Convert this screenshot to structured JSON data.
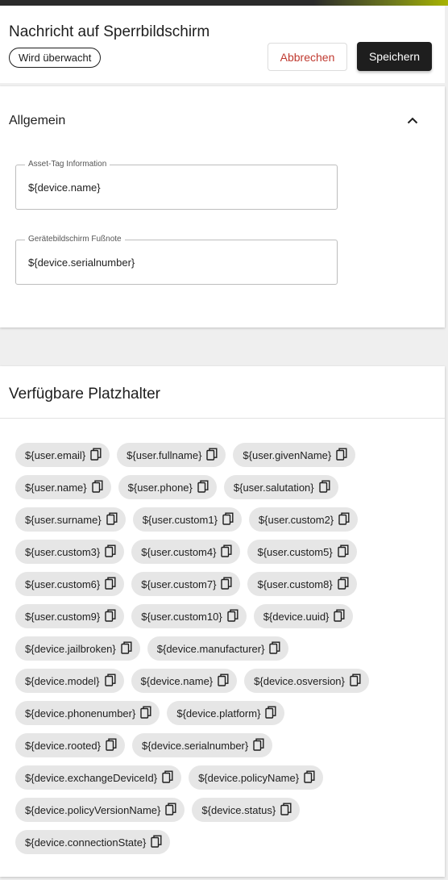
{
  "header": {
    "title": "Nachricht auf Sperrbildschirm",
    "status_badge": "Wird überwacht",
    "cancel_label": "Abbrechen",
    "save_label": "Speichern"
  },
  "general": {
    "title": "Allgemein",
    "collapse_icon": "chevron-up-icon",
    "fields": [
      {
        "label": "Asset-Tag Information",
        "value": "${device.name}"
      },
      {
        "label": "Gerätebildschirm Fußnote",
        "value": "${device.serialnumber}"
      }
    ]
  },
  "placeholders": {
    "title": "Verfügbare Platzhalter",
    "copy_icon": "copy-icon",
    "rows": [
      [
        "${user.email}",
        "${user.fullname}",
        "${user.givenName}"
      ],
      [
        "${user.name}",
        "${user.phone}",
        "${user.salutation}"
      ],
      [
        "${user.surname}",
        "${user.custom1}",
        "${user.custom2}"
      ],
      [
        "${user.custom3}",
        "${user.custom4}",
        "${user.custom5}"
      ],
      [
        "${user.custom6}",
        "${user.custom7}",
        "${user.custom8}"
      ],
      [
        "${user.custom9}",
        "${user.custom10}",
        "${device.uuid}"
      ],
      [
        "${device.jailbroken}",
        "${device.manufacturer}"
      ],
      [
        "${device.model}",
        "${device.name}",
        "${device.osversion}"
      ],
      [
        "${device.phonenumber}",
        "${device.platform}"
      ],
      [
        "${device.rooted}",
        "${device.serialnumber}"
      ],
      [
        "${device.exchangeDeviceId}",
        "${device.policyName}"
      ],
      [
        "${device.policyVersionName}",
        "${device.status}"
      ],
      [
        "${device.connectionState}"
      ]
    ]
  },
  "colors": {
    "primary_button": "#1e1e1e",
    "cancel_text": "#c03a30",
    "chip_background": "#e6e6e6",
    "accent": "#a8b400"
  }
}
